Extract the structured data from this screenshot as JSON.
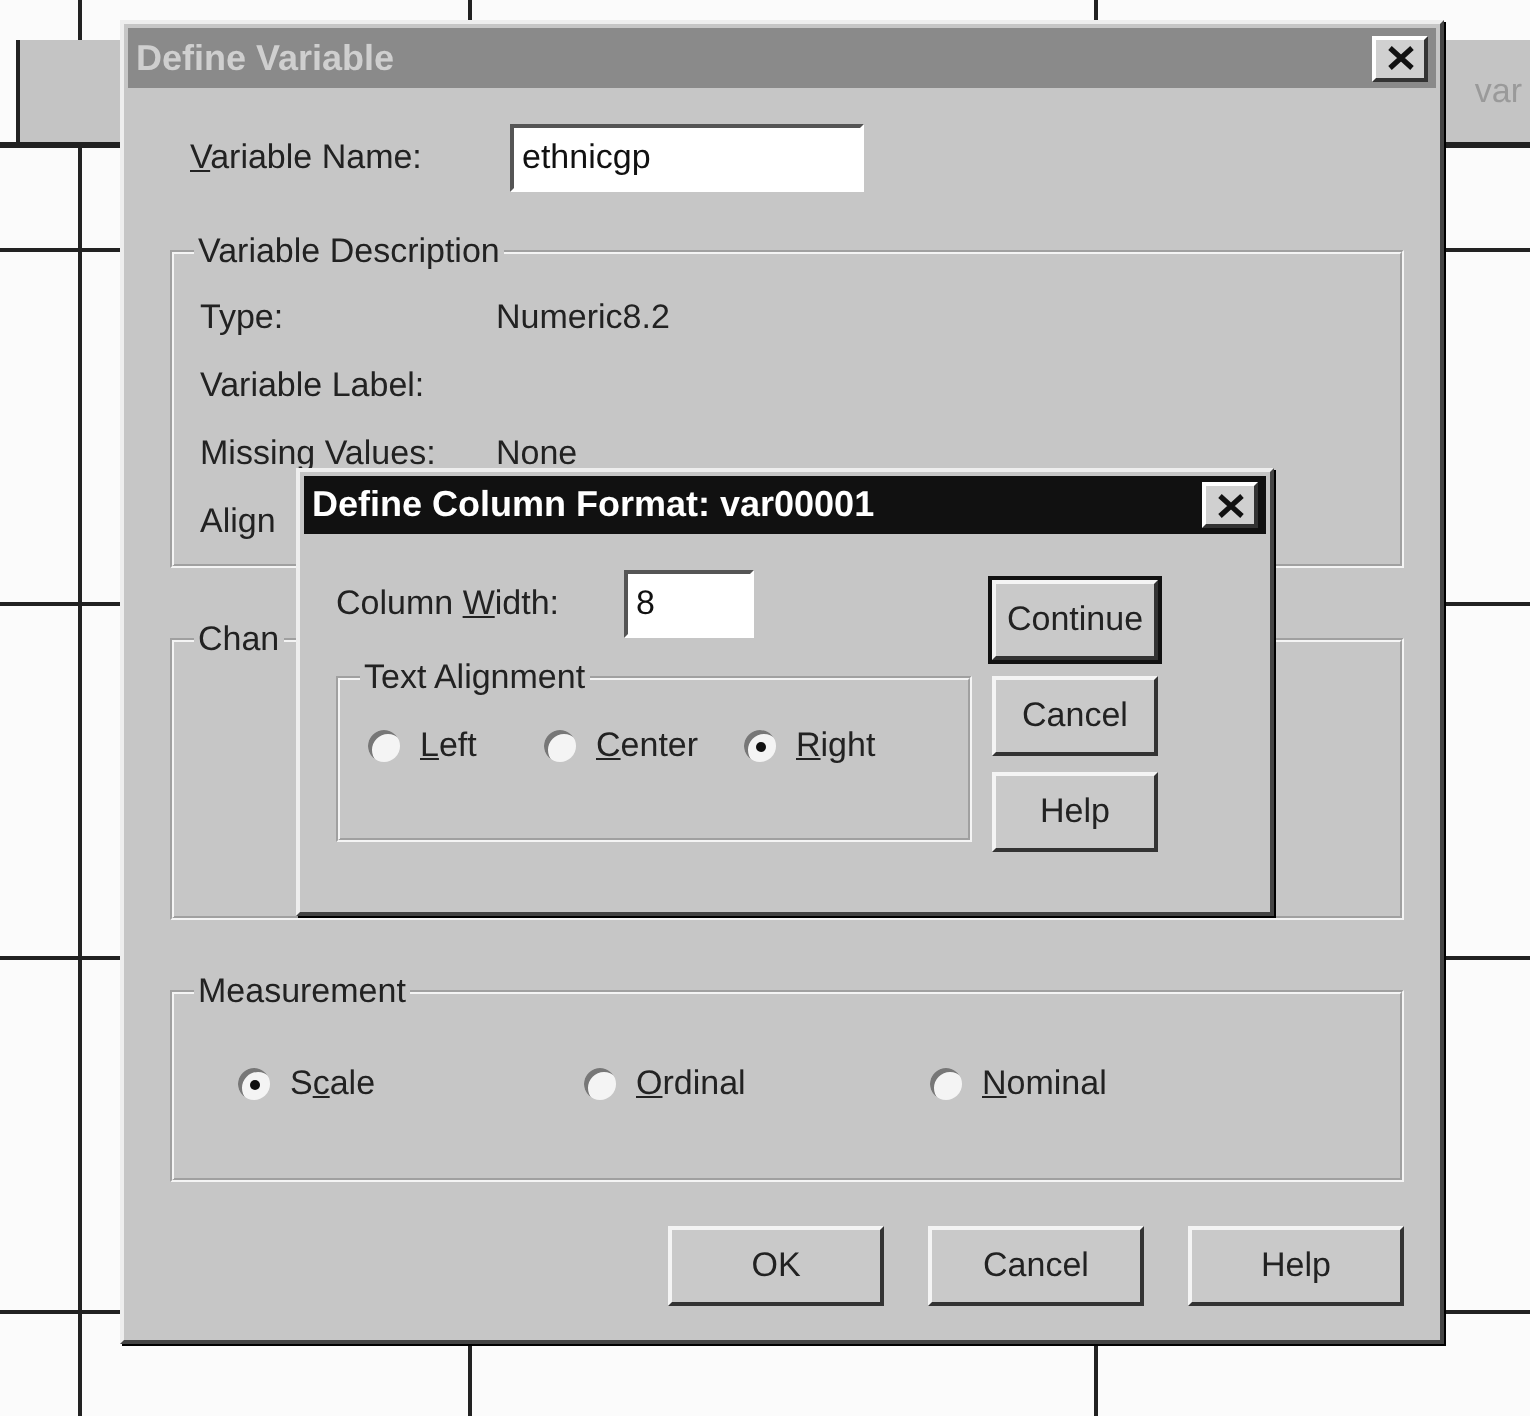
{
  "sheet": {
    "header_text": "var"
  },
  "dialog": {
    "title": "Define Variable",
    "active": false,
    "name_field": {
      "accel": "V",
      "label_end": "ariable Name:",
      "value": "ethnicgp"
    },
    "description": {
      "title": "Variable Description",
      "rows": [
        {
          "label": "Type:",
          "value": "Numeric8.2"
        },
        {
          "label": "Variable Label:"
        },
        {
          "label": "Missing Values:",
          "value": "None"
        },
        {
          "label": "Align"
        }
      ]
    },
    "change_group": {
      "title": "Chan"
    },
    "measurement": {
      "title": "Measurement",
      "options": [
        {
          "label_start": "S",
          "accel": "c",
          "label_end": "ale",
          "selected": true
        },
        {
          "accel": "O",
          "label_end": "rdinal",
          "selected": false
        },
        {
          "accel": "N",
          "label_end": "ominal",
          "selected": false
        }
      ]
    },
    "buttons": [
      {
        "label": "OK",
        "default": false
      },
      {
        "label": "Cancel",
        "default": false
      },
      {
        "label": "Help",
        "default": false
      }
    ]
  },
  "format_dialog": {
    "title": "Define Column Format: var00001",
    "active": true,
    "width_field": {
      "label_start": "Column ",
      "accel": "W",
      "label_end": "idth:",
      "value": "8"
    },
    "alignment": {
      "title": "Text Alignment",
      "options": [
        {
          "accel": "L",
          "label_end": "eft",
          "selected": false
        },
        {
          "accel": "C",
          "label_end": "enter",
          "selected": false
        },
        {
          "accel": "R",
          "label_end": "ight",
          "selected": true
        }
      ]
    },
    "buttons": [
      {
        "label": "Continue",
        "default": true
      },
      {
        "label": "Cancel",
        "default": false
      },
      {
        "label": "Help",
        "default": false
      }
    ]
  }
}
